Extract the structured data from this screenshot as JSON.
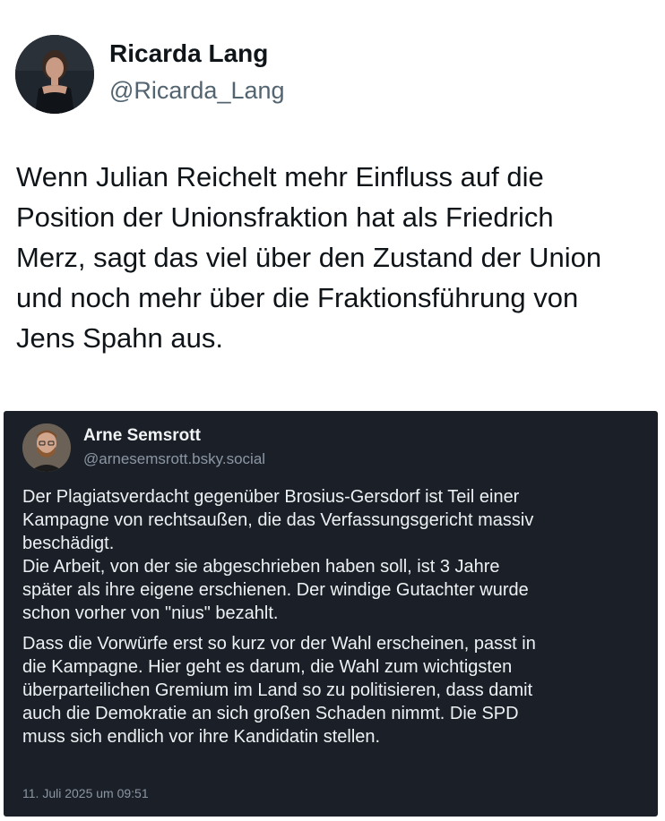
{
  "post": {
    "author_name": "Ricarda Lang",
    "author_handle": "@Ricarda_Lang",
    "text_lines": [
      "Wenn Julian Reichelt mehr Einfluss auf die",
      "Position der Unionsfraktion hat als Friedrich",
      "Merz, sagt das viel über den Zustand der Union",
      "und noch mehr über die Fraktionsführung von",
      "Jens Spahn aus."
    ]
  },
  "quote": {
    "author_name": "Arne Semsrott",
    "author_handle": "@arnesemsrott.bsky.social",
    "paragraph1_lines": [
      "Der Plagiatsverdacht gegenüber Brosius-Gersdorf ist Teil einer",
      "Kampagne von rechtsaußen, die das Verfassungsgericht massiv",
      "beschädigt.",
      "Die Arbeit, von der sie abgeschrieben haben soll, ist 3 Jahre",
      "später als ihre eigene erschienen. Der windige Gutachter wurde",
      "schon vorher von \"nius\" bezahlt."
    ],
    "paragraph2_lines": [
      "Dass die Vorwürfe erst so kurz vor der Wahl erscheinen, passt in",
      "die Kampagne. Hier geht es darum, die Wahl zum wichtigsten",
      "überparteilichen Gremium im Land so zu politisieren, dass damit",
      "auch die Demokratie an sich großen Schaden nimmt. Die SPD",
      "muss sich endlich vor ihre Kandidatin stellen."
    ],
    "date": "11. Juli 2025 um 09:51"
  },
  "colors": {
    "page_background": "#ffffff",
    "text_primary": "#0f1419",
    "text_secondary": "#536471",
    "quote_background": "#1b2028",
    "quote_text": "#eef1f4",
    "quote_muted": "#8c96a3"
  }
}
